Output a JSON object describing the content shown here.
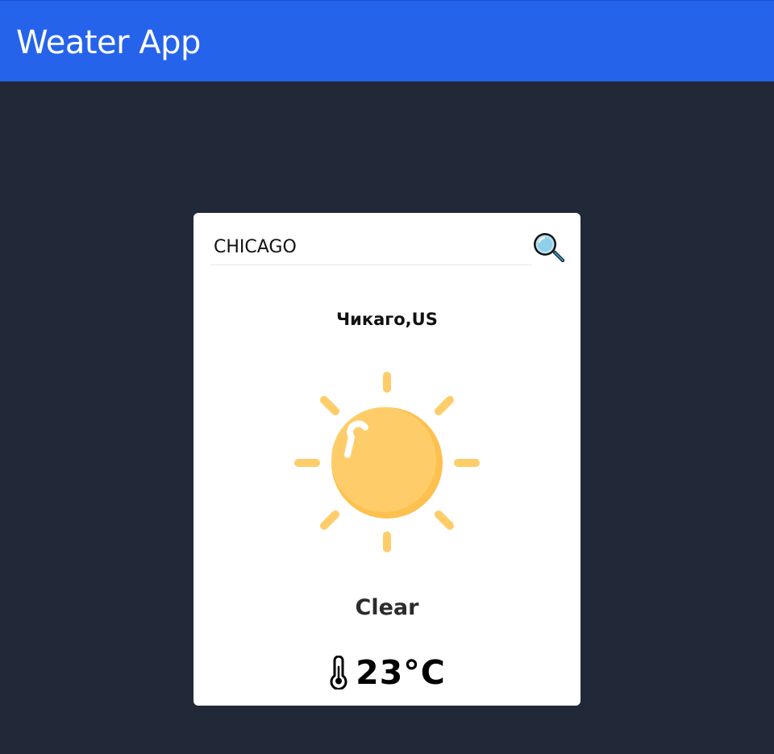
{
  "header": {
    "title": "Weater App",
    "background": "#2563eb"
  },
  "search": {
    "value": "CHICAGO",
    "button_icon": "magnifier-icon"
  },
  "weather": {
    "location": "Чикаго,US",
    "icon": "sun-icon",
    "condition": "Clear",
    "temperature_icon": "thermometer-icon",
    "temperature": "23°C"
  },
  "colors": {
    "page_background": "#212938",
    "card_background": "#ffffff",
    "sun": "#fecd6a"
  }
}
